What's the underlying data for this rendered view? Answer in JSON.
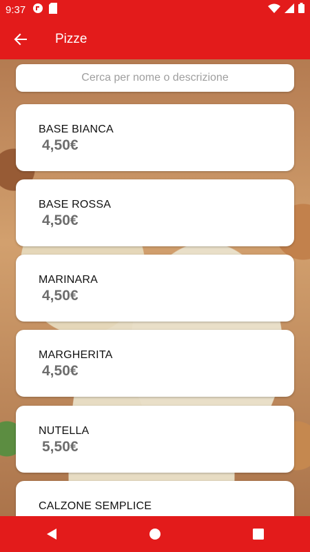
{
  "status_bar": {
    "time": "9:37",
    "left_icons": [
      "notification-app-icon",
      "sd-card-icon"
    ],
    "right_icons": [
      "wifi-icon",
      "signal-icon",
      "battery-icon"
    ]
  },
  "app_bar": {
    "title": "Pizze",
    "back_icon": "arrow-left-icon"
  },
  "search": {
    "placeholder": "Cerca per nome o descrizione",
    "value": ""
  },
  "items": [
    {
      "name": "BASE BIANCA",
      "price": "4,50€"
    },
    {
      "name": "BASE ROSSA",
      "price": "4,50€"
    },
    {
      "name": "MARINARA",
      "price": "4,50€"
    },
    {
      "name": "MARGHERITA",
      "price": "4,50€"
    },
    {
      "name": "NUTELLA",
      "price": "5,50€"
    },
    {
      "name": "CALZONE SEMPLICE",
      "price": ""
    }
  ],
  "nav_bar": {
    "buttons": [
      "back-triangle-icon",
      "home-circle-icon",
      "recents-square-icon"
    ]
  },
  "colors": {
    "primary": "#e31b1b",
    "price_text": "#6d6d6d",
    "placeholder": "#9e9e9e"
  }
}
